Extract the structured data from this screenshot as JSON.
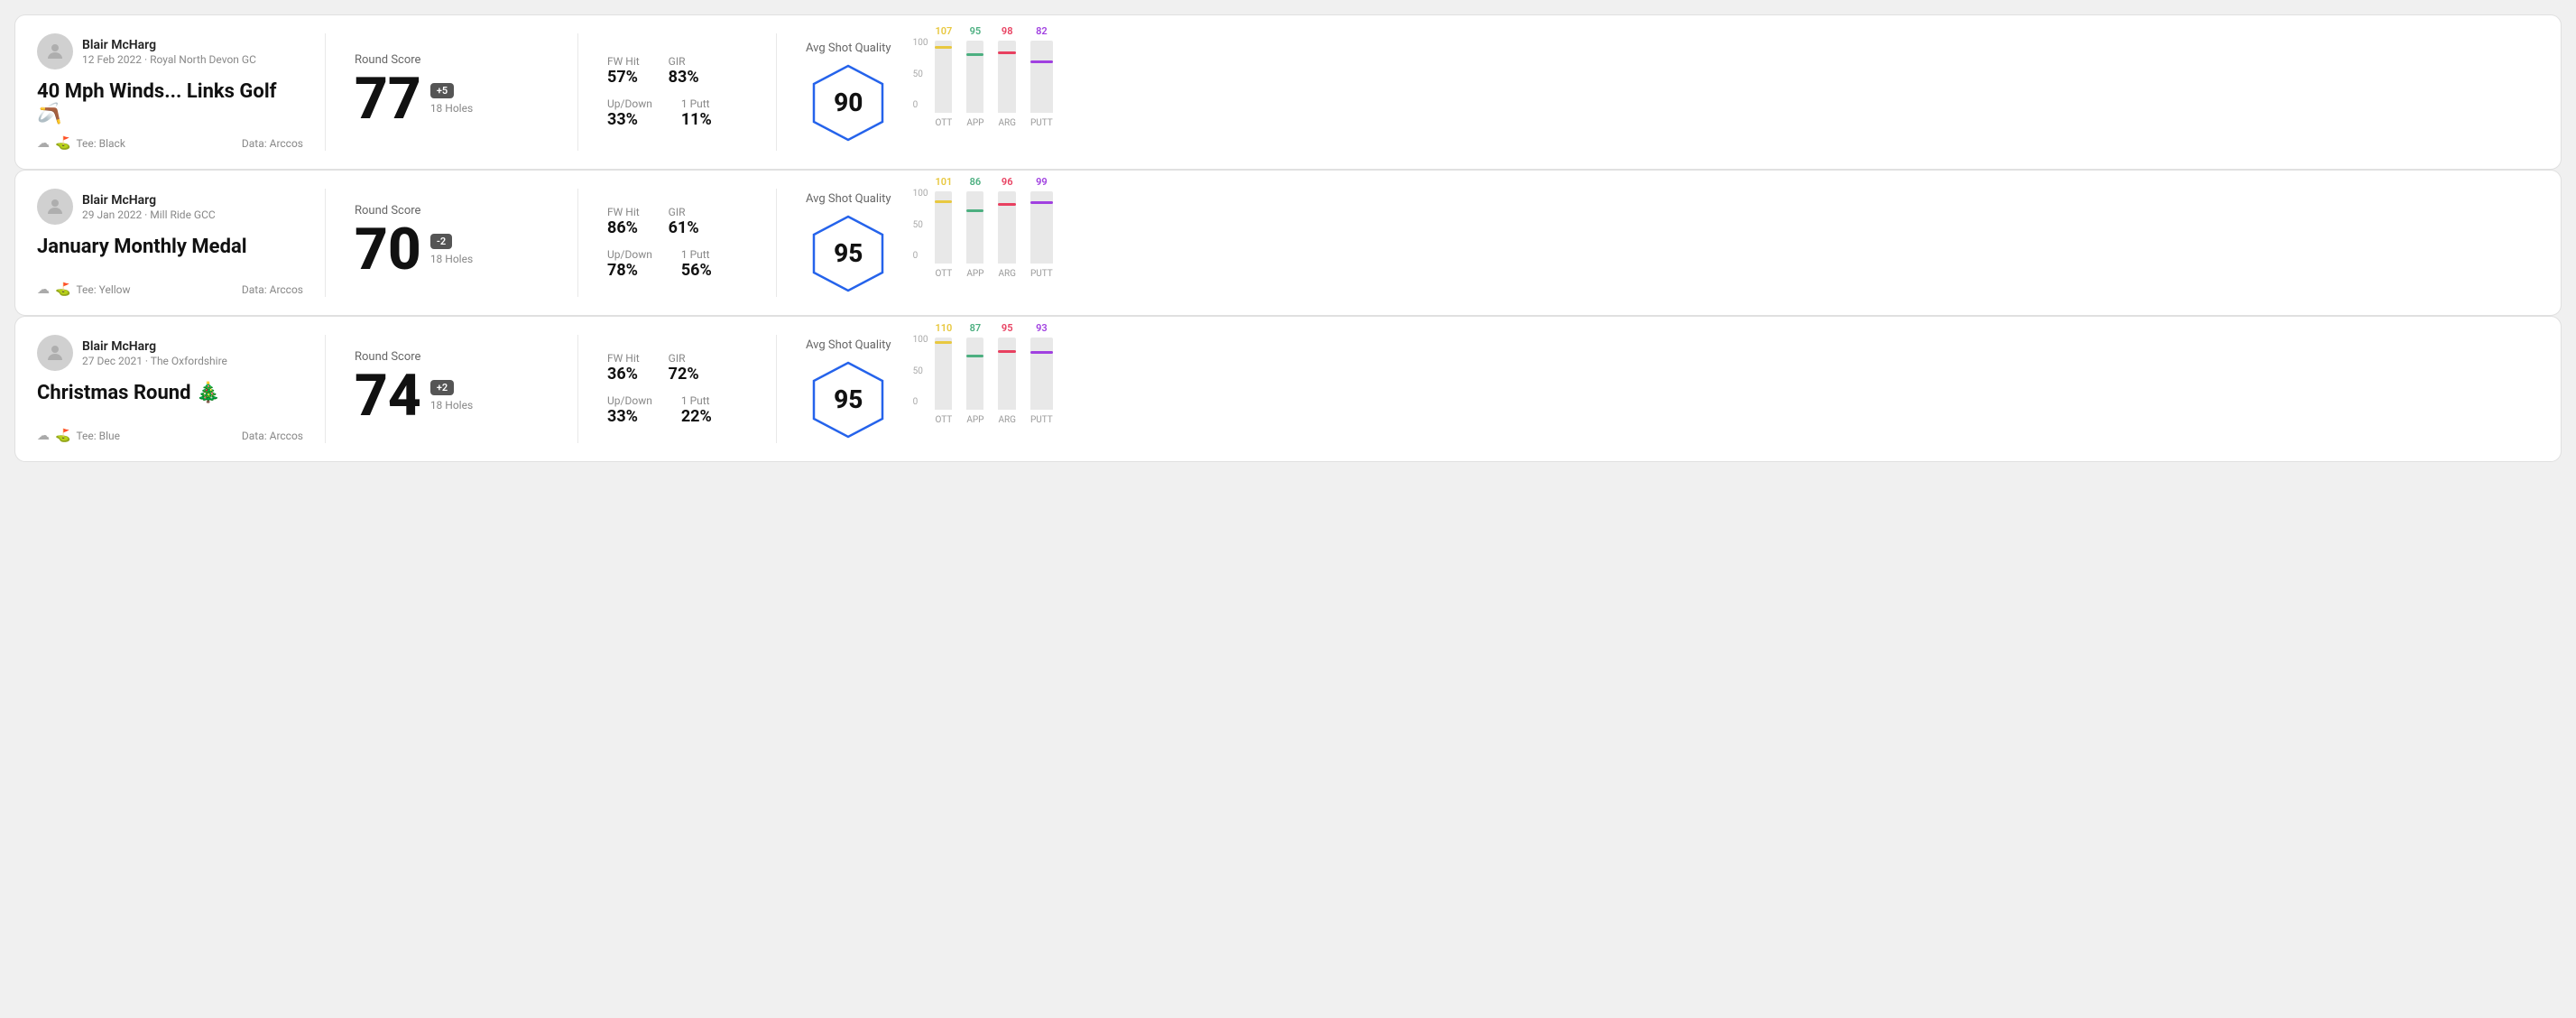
{
  "rounds": [
    {
      "player_name": "Blair McHarg",
      "date_course": "12 Feb 2022 · Royal North Devon GC",
      "title": "40 Mph Winds... Links Golf 🪃",
      "tee": "Black",
      "data_source": "Data: Arccos",
      "round_score_label": "Round Score",
      "score": "77",
      "badge": "+5",
      "holes": "18 Holes",
      "fw_hit_label": "FW Hit",
      "fw_hit": "57%",
      "gir_label": "GIR",
      "gir": "83%",
      "updown_label": "Up/Down",
      "updown": "33%",
      "oneputt_label": "1 Putt",
      "oneputt": "11%",
      "avg_label": "Avg Shot Quality",
      "quality_score": "90",
      "bars": [
        {
          "label": "OTT",
          "value": 107,
          "color": "#e8c840"
        },
        {
          "label": "APP",
          "value": 95,
          "color": "#4caf80"
        },
        {
          "label": "ARG",
          "value": 98,
          "color": "#e84060"
        },
        {
          "label": "PUTT",
          "value": 82,
          "color": "#a040e0"
        }
      ]
    },
    {
      "player_name": "Blair McHarg",
      "date_course": "29 Jan 2022 · Mill Ride GCC",
      "title": "January Monthly Medal",
      "tee": "Yellow",
      "data_source": "Data: Arccos",
      "round_score_label": "Round Score",
      "score": "70",
      "badge": "-2",
      "holes": "18 Holes",
      "fw_hit_label": "FW Hit",
      "fw_hit": "86%",
      "gir_label": "GIR",
      "gir": "61%",
      "updown_label": "Up/Down",
      "updown": "78%",
      "oneputt_label": "1 Putt",
      "oneputt": "56%",
      "avg_label": "Avg Shot Quality",
      "quality_score": "95",
      "bars": [
        {
          "label": "OTT",
          "value": 101,
          "color": "#e8c840"
        },
        {
          "label": "APP",
          "value": 86,
          "color": "#4caf80"
        },
        {
          "label": "ARG",
          "value": 96,
          "color": "#e84060"
        },
        {
          "label": "PUTT",
          "value": 99,
          "color": "#a040e0"
        }
      ]
    },
    {
      "player_name": "Blair McHarg",
      "date_course": "27 Dec 2021 · The Oxfordshire",
      "title": "Christmas Round 🎄",
      "tee": "Blue",
      "data_source": "Data: Arccos",
      "round_score_label": "Round Score",
      "score": "74",
      "badge": "+2",
      "holes": "18 Holes",
      "fw_hit_label": "FW Hit",
      "fw_hit": "36%",
      "gir_label": "GIR",
      "gir": "72%",
      "updown_label": "Up/Down",
      "updown": "33%",
      "oneputt_label": "1 Putt",
      "oneputt": "22%",
      "avg_label": "Avg Shot Quality",
      "quality_score": "95",
      "bars": [
        {
          "label": "OTT",
          "value": 110,
          "color": "#e8c840"
        },
        {
          "label": "APP",
          "value": 87,
          "color": "#4caf80"
        },
        {
          "label": "ARG",
          "value": 95,
          "color": "#e84060"
        },
        {
          "label": "PUTT",
          "value": 93,
          "color": "#a040e0"
        }
      ]
    }
  ]
}
